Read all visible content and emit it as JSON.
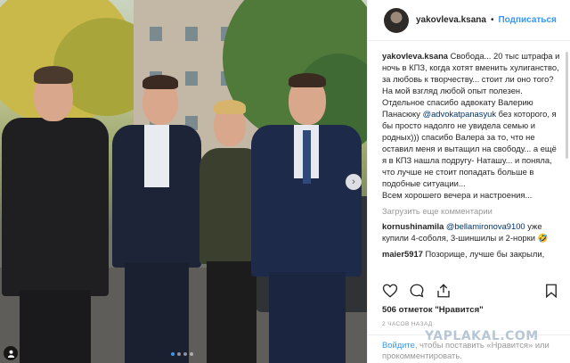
{
  "post": {
    "username": "yakovleva.ksana",
    "separator": "•",
    "follow_label": "Подписаться"
  },
  "caption": {
    "author": "yakovleva.ksana",
    "text_1": " Свобода... 20 тыс штрафа и ночь в КПЗ, когда хотят вменить хулиганство, за любовь к творчеству... стоит ли оно того? На мой взгляд любой опыт полезен. Отдельное спасибо адвокату Валерию Панасюку ",
    "mention": "@advokatpanasyuk",
    "text_2": " без которого, я бы просто надолго не увидела семью и родных))) спасибо Валера за то, что не оставил меня и вытащил на свободу... а ещё я в КПЗ нашла подругу- Наташу... и поняла, что лучше не стоит попадать больше в подобные ситуации...",
    "text_3": "Всем хорошего вечера и настроения..."
  },
  "load_more_label": "Загрузить еще комментарии",
  "comments": [
    {
      "author": "kornushinamila",
      "mention": "@bellamironova9100",
      "text": " уже купили 4-соболя, 3-шиншилы и 2-норки 🤣"
    },
    {
      "author": "maier5917",
      "mention": "",
      "text": " Позорище, лучше бы закрыли,"
    }
  ],
  "likes_text": "506 отметок \"Нравится\"",
  "timestamp": "2 ЧАСОВ НАЗАД",
  "login": {
    "link": "Войдите",
    "text": ", чтобы поставить «Нравится» или прокомментировать."
  },
  "watermark": "YAPLAKAL.COM",
  "carousel": {
    "arrow": "›",
    "total_slides": 4,
    "active_slide": 1
  },
  "icons": [
    "heart-icon",
    "comment-icon",
    "share-icon",
    "bookmark-icon",
    "person-tag-icon",
    "chevron-right-icon"
  ]
}
